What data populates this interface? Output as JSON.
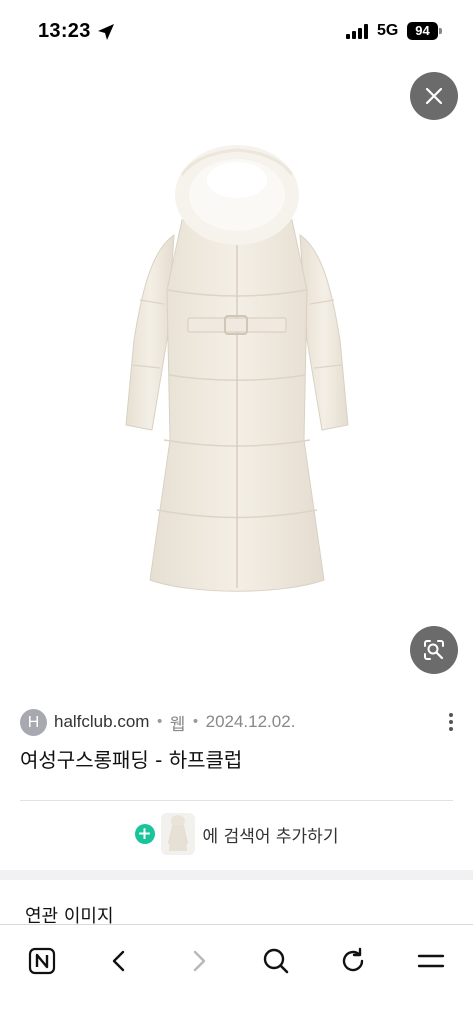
{
  "status_bar": {
    "time": "13:23",
    "network": "5G",
    "battery": "94"
  },
  "viewer": {
    "close_icon": "close-icon",
    "lens_icon": "image-search-lens-icon",
    "image_subject": "product-image"
  },
  "source": {
    "favicon_letter": "H",
    "domain": "halfclub.com",
    "separator": "•",
    "type": "웹",
    "date": "2024.12.02.",
    "title": "여성구스롱패딩 - 하프클럽"
  },
  "add_search": {
    "label": "에 검색어 추가하기"
  },
  "related": {
    "title": "연관 이미지"
  },
  "toolbar": {
    "home_icon": "naver-n-icon",
    "back_icon": "chevron-left-icon",
    "forward_icon": "chevron-right-icon",
    "search_icon": "search-icon",
    "reload_icon": "reload-icon",
    "menu_icon": "menu-icon"
  },
  "colors": {
    "accent_green": "#18c59a",
    "overlay_button": "#6b6b6b",
    "coat": "#f2ece2"
  }
}
